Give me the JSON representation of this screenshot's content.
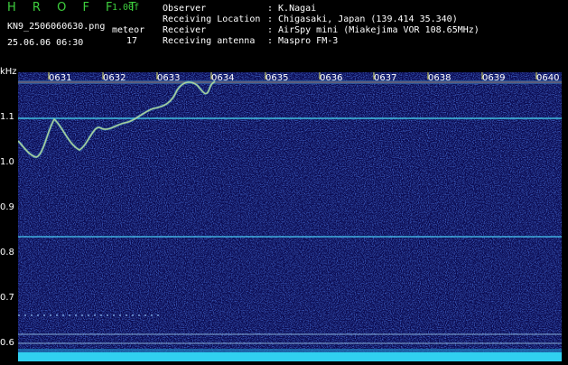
{
  "header": {
    "brand": "H R O F F T",
    "version": "1.00f",
    "filename": "KN9_2506060630.png",
    "datetime": "25.06.06 06:30",
    "meteor_label": "meteor",
    "meteor_count": "17"
  },
  "info": {
    "rows": [
      {
        "key": "Observer",
        "value": ": K.Nagai"
      },
      {
        "key": "Receiving Location",
        "value": ": Chigasaki, Japan (139.414 35.340)"
      },
      {
        "key": "Receiver",
        "value": ": AirSpy mini (Miakejima VOR 108.65MHz)"
      },
      {
        "key": "Receiving antenna",
        "value": ": Maspro FM-3"
      }
    ]
  },
  "axis": {
    "unit": "kHz",
    "y_ticks": [
      "1.1",
      "1.0",
      "0.9",
      "0.8",
      "0.7",
      "0.6"
    ],
    "time_labels": [
      "0631",
      "0632",
      "0633",
      "0634",
      "0635",
      "0636",
      "0637",
      "0638",
      "0639",
      "0640"
    ]
  },
  "colors": {
    "background": "#000000",
    "spectrum_base": "#0a0a50",
    "brand_green": "#3ecf3e",
    "carrier_line": "#40c0e0",
    "meteor_trace": "#e0e080"
  }
}
